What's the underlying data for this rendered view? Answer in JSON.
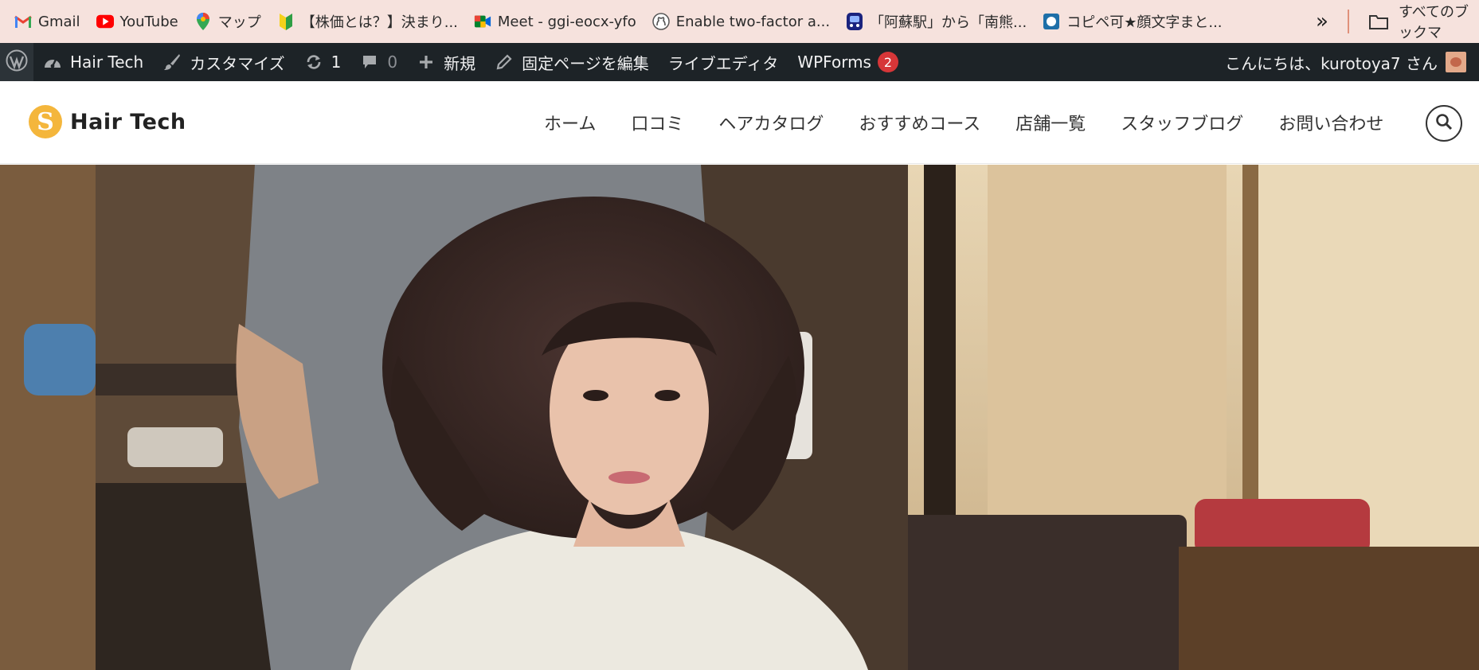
{
  "bookmarks": {
    "items": [
      {
        "label": "Gmail",
        "icon": "gmail-icon"
      },
      {
        "label": "YouTube",
        "icon": "youtube-icon"
      },
      {
        "label": "マップ",
        "icon": "maps-icon"
      },
      {
        "label": "【株価とは？】決まり...",
        "icon": "beginner-mark-icon"
      },
      {
        "label": "Meet - ggi-eocx-yfo",
        "icon": "meet-icon"
      },
      {
        "label": "Enable two-factor a...",
        "icon": "github-icon"
      },
      {
        "label": "「阿蘇駅」から「南熊...",
        "icon": "transit-icon"
      },
      {
        "label": "コピペ可★顔文字まと...",
        "icon": "site-icon"
      }
    ],
    "more_icon": "double-chevron-icon",
    "all_bookmarks_label": "すべてのブックマ"
  },
  "adminbar": {
    "site_name": "Hair Tech",
    "customize": "カスタマイズ",
    "updates_count": "1",
    "comments_count": "0",
    "new": "新規",
    "edit_page": "固定ページを編集",
    "live_editor": "ライブエディタ",
    "wpforms": "WPForms",
    "wpforms_badge": "2",
    "greeting": "こんにちは、kurotoya7 さん"
  },
  "site": {
    "logo_letter": "S",
    "logo_text": "Hair Tech",
    "nav": [
      "ホーム",
      "口コミ",
      "ヘアカタログ",
      "おすすめコース",
      "店舗一覧",
      "スタッフブログ",
      "お問い合わせ"
    ]
  },
  "colors": {
    "bookmark_bar": "#f6e2dd",
    "admin_bar": "#1d2327",
    "badge": "#d63638",
    "logo_accent": "#f4b63c"
  }
}
